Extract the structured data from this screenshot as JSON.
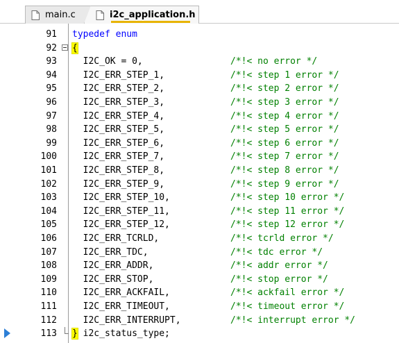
{
  "tabs": [
    {
      "label": "main.c",
      "active": false,
      "icon": "file-icon"
    },
    {
      "label": "i2c_application.h",
      "active": true,
      "icon": "file-icon"
    }
  ],
  "editor": {
    "lines": [
      {
        "no": "91",
        "code": "",
        "kw": "typedef enum",
        "comment": ""
      },
      {
        "no": "92",
        "code": "{",
        "kw": "",
        "comment": ""
      },
      {
        "no": "93",
        "code": "  I2C_OK = 0,",
        "kw": "",
        "comment": "/*!< no error */"
      },
      {
        "no": "94",
        "code": "  I2C_ERR_STEP_1,",
        "kw": "",
        "comment": "/*!< step 1 error */"
      },
      {
        "no": "95",
        "code": "  I2C_ERR_STEP_2,",
        "kw": "",
        "comment": "/*!< step 2 error */"
      },
      {
        "no": "96",
        "code": "  I2C_ERR_STEP_3,",
        "kw": "",
        "comment": "/*!< step 3 error */"
      },
      {
        "no": "97",
        "code": "  I2C_ERR_STEP_4,",
        "kw": "",
        "comment": "/*!< step 4 error */"
      },
      {
        "no": "98",
        "code": "  I2C_ERR_STEP_5,",
        "kw": "",
        "comment": "/*!< step 5 error */"
      },
      {
        "no": "99",
        "code": "  I2C_ERR_STEP_6,",
        "kw": "",
        "comment": "/*!< step 6 error */"
      },
      {
        "no": "100",
        "code": "  I2C_ERR_STEP_7,",
        "kw": "",
        "comment": "/*!< step 7 error */"
      },
      {
        "no": "101",
        "code": "  I2C_ERR_STEP_8,",
        "kw": "",
        "comment": "/*!< step 8 error */"
      },
      {
        "no": "102",
        "code": "  I2C_ERR_STEP_9,",
        "kw": "",
        "comment": "/*!< step 9 error */"
      },
      {
        "no": "103",
        "code": "  I2C_ERR_STEP_10,",
        "kw": "",
        "comment": "/*!< step 10 error */"
      },
      {
        "no": "104",
        "code": "  I2C_ERR_STEP_11,",
        "kw": "",
        "comment": "/*!< step 11 error */"
      },
      {
        "no": "105",
        "code": "  I2C_ERR_STEP_12,",
        "kw": "",
        "comment": "/*!< step 12 error */"
      },
      {
        "no": "106",
        "code": "  I2C_ERR_TCRLD,",
        "kw": "",
        "comment": "/*!< tcrld error */"
      },
      {
        "no": "107",
        "code": "  I2C_ERR_TDC,",
        "kw": "",
        "comment": "/*!< tdc error */"
      },
      {
        "no": "108",
        "code": "  I2C_ERR_ADDR,",
        "kw": "",
        "comment": "/*!< addr error */"
      },
      {
        "no": "109",
        "code": "  I2C_ERR_STOP,",
        "kw": "",
        "comment": "/*!< stop error */"
      },
      {
        "no": "110",
        "code": "  I2C_ERR_ACKFAIL,",
        "kw": "",
        "comment": "/*!< ackfail error */"
      },
      {
        "no": "111",
        "code": "  I2C_ERR_TIMEOUT,",
        "kw": "",
        "comment": "/*!< timeout error */"
      },
      {
        "no": "112",
        "code": "  I2C_ERR_INTERRUPT,",
        "kw": "",
        "comment": "/*!< interrupt error */"
      },
      {
        "no": "113",
        "code": " i2c_status_type;",
        "kw": "",
        "comment": "",
        "brace": "}"
      }
    ]
  },
  "colors": {
    "keyword": "#0000ff",
    "comment": "#008000",
    "active_tab_underline": "#e8b400",
    "brace_highlight": "#ffff00",
    "current_line_marker": "#2d7fd6"
  }
}
